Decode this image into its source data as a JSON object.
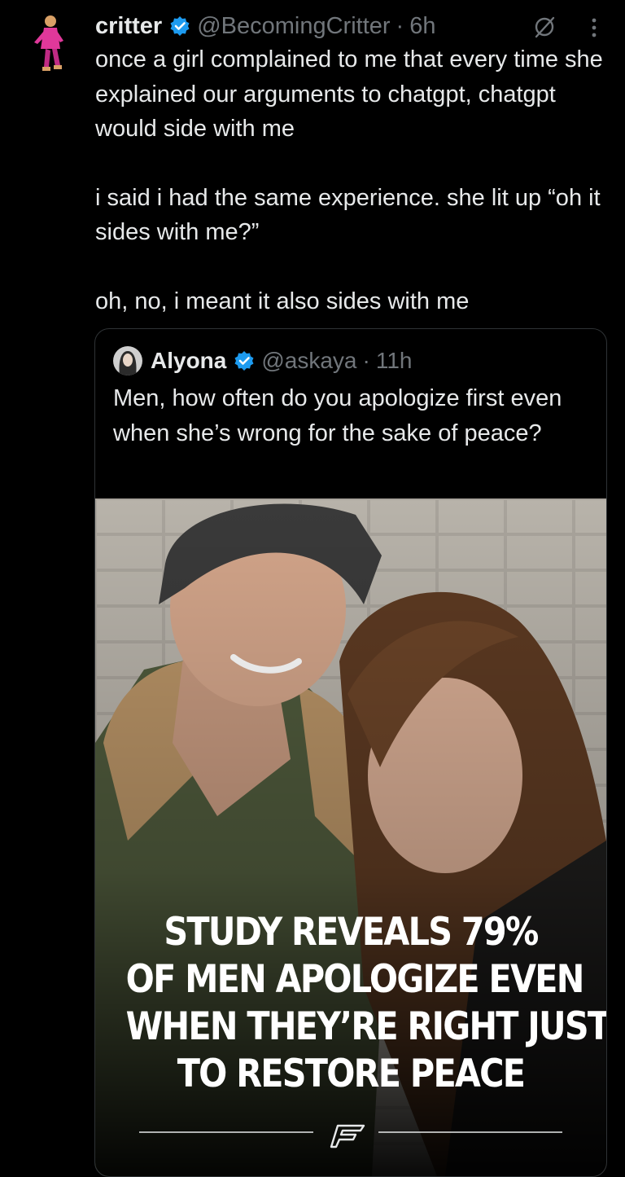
{
  "tweet": {
    "author_name": "critter",
    "author_handle": "@BecomingCritter",
    "separator": "·",
    "time": "6h",
    "paragraphs": [
      "once a girl complained to me that every time she explained our arguments to chatgpt, chatgpt would side with me",
      "i said i had the same experience. she lit up “oh it sides with me?”",
      "oh, no, i meant it also sides with me"
    ]
  },
  "quoted_tweet": {
    "author_name": "Alyona",
    "author_handle": "@askaya",
    "separator": "·",
    "time": "11h",
    "text": "Men, how often do you apologize first even when she’s wrong for the sake of peace?",
    "media": {
      "headline_lines": [
        "STUDY REVEALS 79%",
        "OF MEN APOLOGIZE EVEN",
        "WHEN THEY’RE RIGHT JUST",
        "TO RESTORE PEACE"
      ],
      "logo_icon": "publisher-logo-icon"
    }
  },
  "icons": {
    "verified": "verified-badge-icon",
    "grok": "grok-icon",
    "more": "more-options-icon"
  },
  "colors": {
    "background": "#000000",
    "text_primary": "#e7e9ea",
    "text_secondary": "#71767b",
    "verified_blue": "#1d9bf0",
    "border": "#2f3336"
  }
}
